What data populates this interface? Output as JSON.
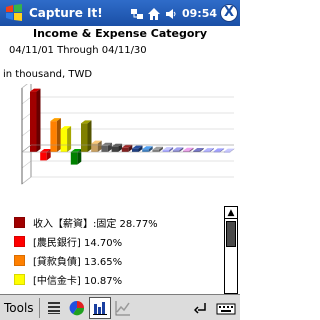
{
  "window": {
    "title": "Capture It!",
    "time": "09:54",
    "close_label": "X"
  },
  "report": {
    "title": "Income & Expense Category",
    "date_range": "04/11/01 Through 04/11/30",
    "unit": "in thousand, TWD"
  },
  "chart_data": {
    "type": "bar",
    "series": [
      {
        "name": "收入【薪資】:固定",
        "values": [
          28.77
        ]
      },
      {
        "name": "[農民銀行]",
        "values": [
          14.7
        ]
      },
      {
        "name": "[貸款負債]",
        "values": [
          13.65
        ]
      },
      {
        "name": "[中信金卡]",
        "values": [
          10.87
        ]
      }
    ],
    "colors": [
      "#a00000",
      "#ff0000",
      "#ff8000",
      "#ffff00",
      "#008000",
      "#808000",
      "#c8a060",
      "#606060",
      "#404040",
      "#802020",
      "#204080",
      "#4080c0",
      "#808080",
      "#a0a0ff",
      "#8080c0",
      "#c080c0",
      "#6060a0",
      "#9090ff",
      "#8080ff",
      "#a0a0e0"
    ]
  },
  "legend": {
    "items": [
      {
        "label": "收入【薪資】:固定 28.77%",
        "color": "#a00000"
      },
      {
        "label": "[農民銀行] 14.70%",
        "color": "#ff0000"
      },
      {
        "label": "[貸款負債] 13.65%",
        "color": "#ff8000"
      },
      {
        "label": "[中信金卡] 10.87%",
        "color": "#ffff00"
      }
    ]
  },
  "toolbar": {
    "tools_label": "Tools",
    "buttons": [
      "list-icon",
      "pie-chart-icon",
      "bar-chart-icon",
      "line-chart-icon"
    ],
    "active": "bar-chart-icon"
  }
}
